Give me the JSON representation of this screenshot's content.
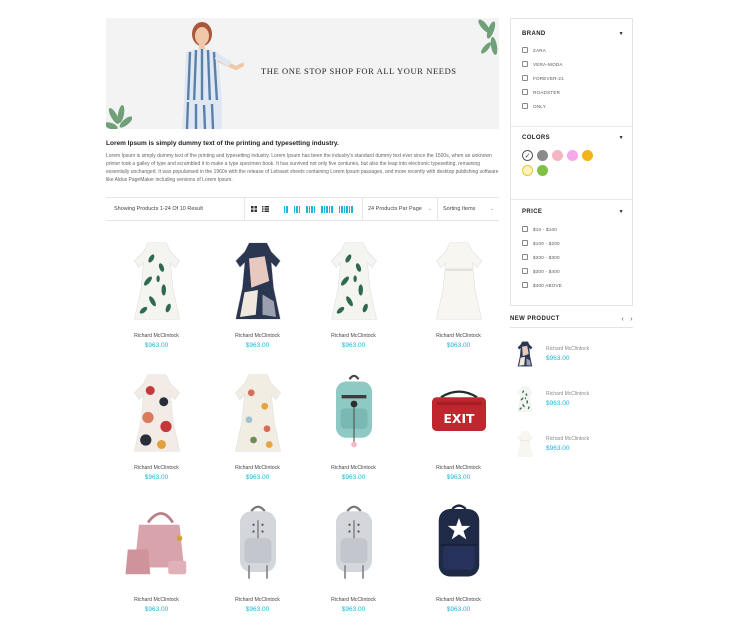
{
  "banner": {
    "tagline": "THE ONE STOP SHOP FOR ALL YOUR NEEDS"
  },
  "intro": {
    "title": "Lorem Ipsum is simply dummy text of the printing and typesetting industry.",
    "text": "Lorem Ipsum is simply dummy text of the printing and typesetting industry. Lorem Ipsum has been the industry's standard dummy text ever since the 1500s, when an unknown printer took a galley of type and scrambled it to make a type specimen book. It has survived not only five centuries, but also the leap into electronic typesetting, remaining essentially unchanged. It was popularised in the 1960s with the release of Letraset sheets containing Lorem Ipsum passages, and more recently with desktop publishing software like Aldus PageMaker including versions of Lorem Ipsum."
  },
  "toolbar": {
    "showing": "Showing Products 1-24 Of 10 Result",
    "per_page": "24 Products Par Page",
    "sorting": "Sorting Items"
  },
  "products": [
    {
      "name": "Richard McClintock",
      "price": "$963.00",
      "kind": "dress-green"
    },
    {
      "name": "Richard McClintock",
      "price": "$963.00",
      "kind": "dress-navy"
    },
    {
      "name": "Richard McClintock",
      "price": "$963.00",
      "kind": "dress-green"
    },
    {
      "name": "Richard McClintock",
      "price": "$963.00",
      "kind": "dress-white"
    },
    {
      "name": "Richard McClintock",
      "price": "$963.00",
      "kind": "dress-red"
    },
    {
      "name": "Richard McClintock",
      "price": "$963.00",
      "kind": "dress-floral"
    },
    {
      "name": "Richard McClintock",
      "price": "$963.00",
      "kind": "backpack-teal"
    },
    {
      "name": "Richard McClintock",
      "price": "$963.00",
      "kind": "bag-exit"
    },
    {
      "name": "Richard McClintock",
      "price": "$963.00",
      "kind": "handbag-pink"
    },
    {
      "name": "Richard McClintock",
      "price": "$963.00",
      "kind": "backpack-grey"
    },
    {
      "name": "Richard McClintock",
      "price": "$963.00",
      "kind": "backpack-grey"
    },
    {
      "name": "Richard McClintock",
      "price": "$963.00",
      "kind": "backpack-navy"
    }
  ],
  "exit_label": "EXIT",
  "sidebar": {
    "brand": {
      "title": "BRAND",
      "items": [
        "ZARA",
        "VERA-MODA",
        "FOREVER-21",
        "ROADSTER",
        "ONLY"
      ]
    },
    "colors": {
      "title": "COLORS",
      "swatches": [
        "#ffffff",
        "#8a8a8a",
        "#f6b6c1",
        "#f7a8e8",
        "#f2b41a",
        "#fdf3b8",
        "#7dc242"
      ]
    },
    "price": {
      "title": "PRICE",
      "items": [
        "$10 - $100",
        "$100 - $200",
        "$200 - $300",
        "$300 - $400",
        "$400 ABOVE"
      ]
    }
  },
  "new_product": {
    "title": "NEW PRODUCT",
    "items": [
      {
        "name": "Richard McClintock",
        "price": "$963.00",
        "kind": "dress-navy"
      },
      {
        "name": "Richard McClintock",
        "price": "$963.00",
        "kind": "dress-green"
      },
      {
        "name": "Richard McClintock",
        "price": "$963.00",
        "kind": "dress-white"
      }
    ]
  },
  "colors": {
    "accent": "#1bb6d8",
    "border": "#e6e6e6"
  }
}
